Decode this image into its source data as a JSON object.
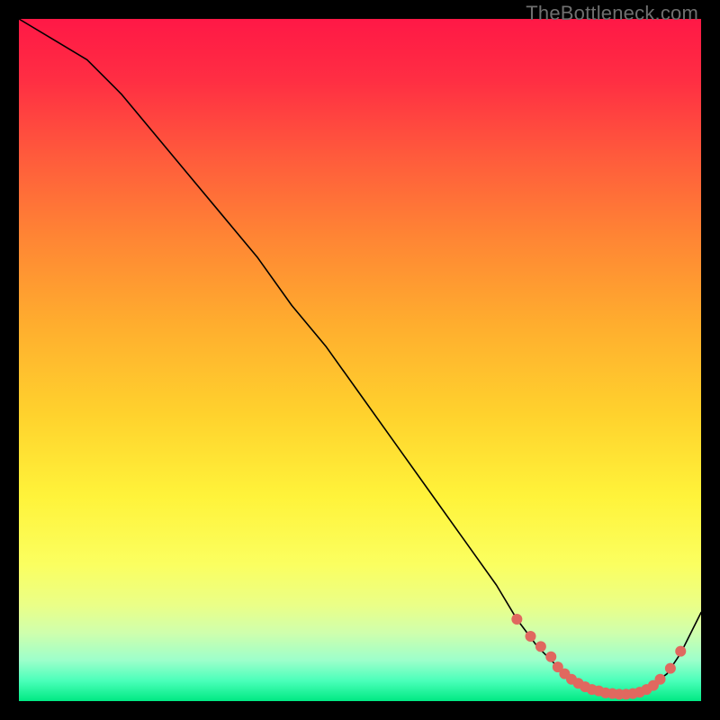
{
  "watermark": "TheBottleneck.com",
  "chart_data": {
    "type": "line",
    "title": "",
    "xlabel": "",
    "ylabel": "",
    "xlim": [
      0,
      100
    ],
    "ylim": [
      0,
      100
    ],
    "series": [
      {
        "name": "curve",
        "x": [
          0,
          5,
          10,
          15,
          20,
          25,
          30,
          35,
          40,
          45,
          50,
          55,
          60,
          65,
          70,
          73,
          76,
          79,
          81,
          83,
          85,
          87,
          89,
          91,
          93,
          95,
          97,
          100
        ],
        "y": [
          100,
          97,
          94,
          89,
          83,
          77,
          71,
          65,
          58,
          52,
          45,
          38,
          31,
          24,
          17,
          12,
          8,
          5,
          3,
          2,
          1.5,
          1,
          1,
          1.5,
          2.5,
          4,
          7,
          13
        ]
      }
    ],
    "highlight_points": {
      "name": "near-bottom-dots",
      "x": [
        73,
        75,
        76.5,
        78,
        79,
        80,
        81,
        82,
        83,
        84,
        85,
        86,
        87,
        88,
        89,
        90,
        91,
        92,
        93,
        94,
        95.5,
        97
      ],
      "y": [
        12,
        9.5,
        8,
        6.5,
        5,
        4,
        3.2,
        2.6,
        2.1,
        1.7,
        1.5,
        1.2,
        1.1,
        1.0,
        1.0,
        1.1,
        1.3,
        1.7,
        2.3,
        3.2,
        4.8,
        7.3
      ]
    }
  },
  "colors": {
    "curve_stroke": "#000000",
    "dot_fill": "#e0685f",
    "page_bg": "#000000"
  }
}
